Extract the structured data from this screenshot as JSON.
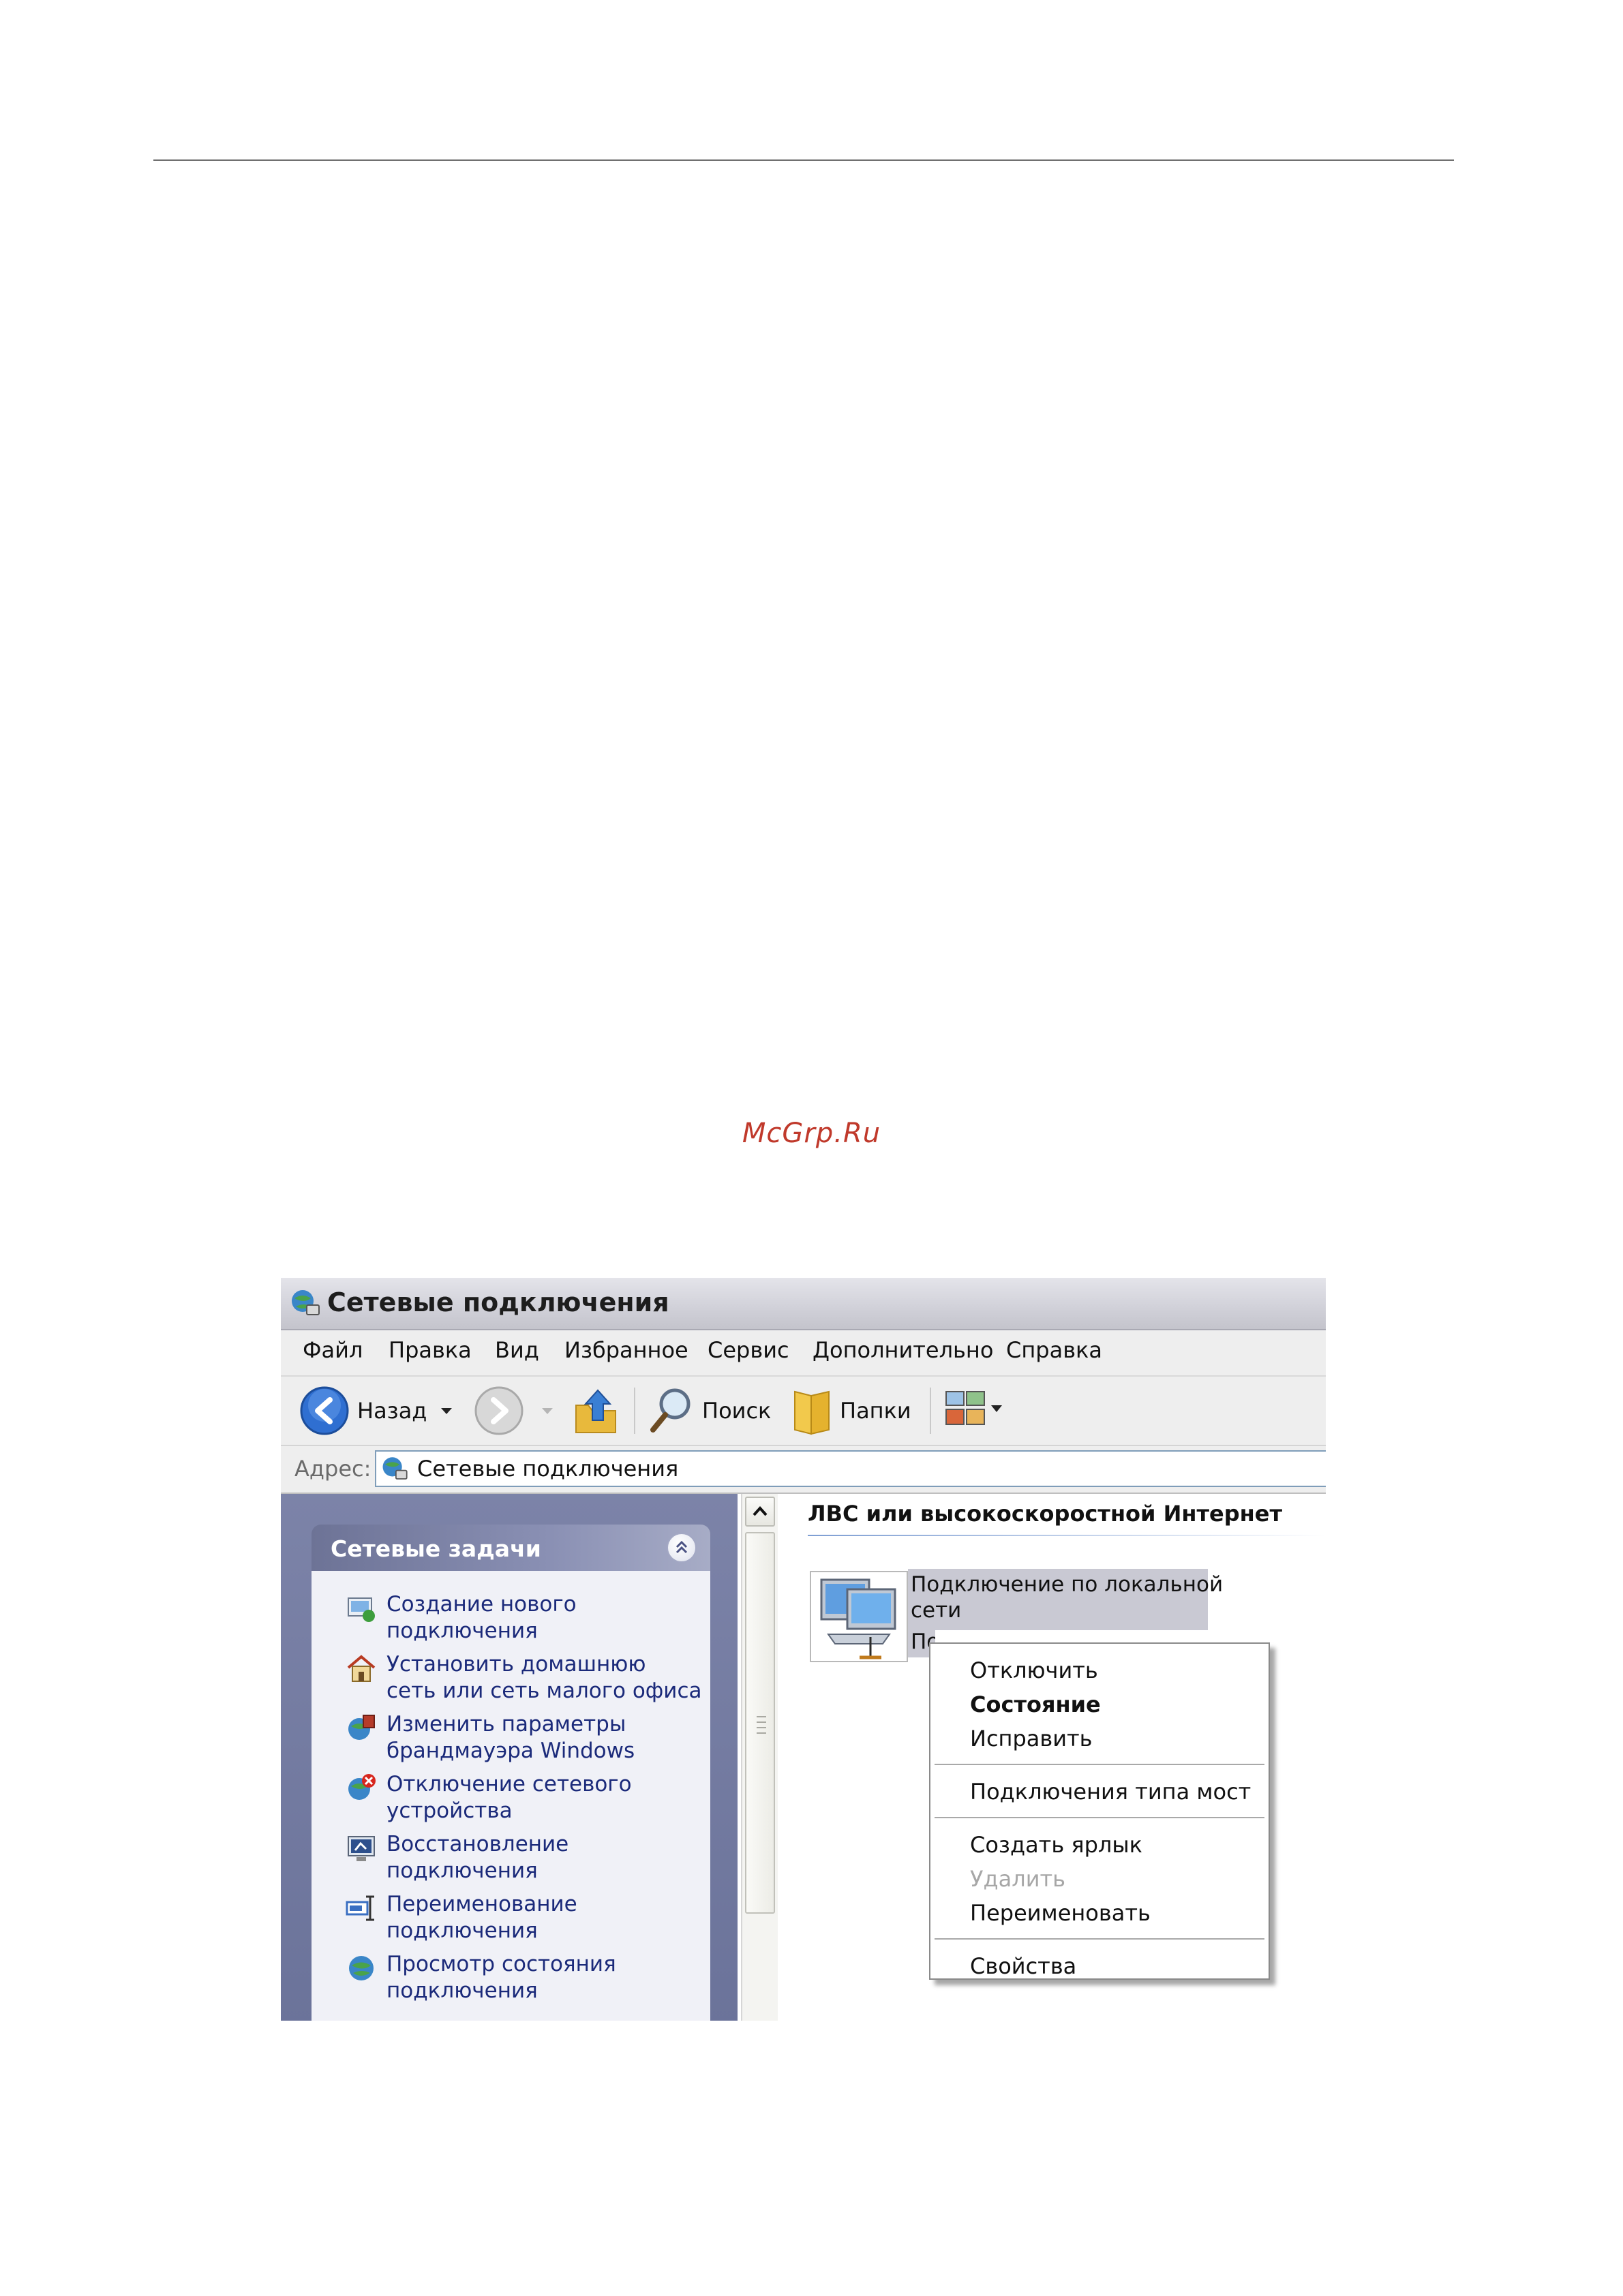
{
  "watermark": "McGrp.Ru",
  "window": {
    "title": "Сетевые подключения",
    "menu": [
      "Файл",
      "Правка",
      "Вид",
      "Избранное",
      "Сервис",
      "Дополнительно",
      "Справка"
    ],
    "toolbar": {
      "back_label": "Назад",
      "search_label": "Поиск",
      "folders_label": "Папки"
    },
    "address": {
      "label": "Адрес:",
      "value": "Сетевые подключения"
    }
  },
  "tasks": {
    "header": "Сетевые задачи",
    "items": [
      {
        "line1": "Создание нового",
        "line2": "подключения",
        "icon": "new-connection-icon"
      },
      {
        "line1": "Установить домашнюю",
        "line2": "сеть или сеть малого офиса",
        "icon": "home-network-icon"
      },
      {
        "line1": "Изменить параметры",
        "line2": "брандмауэра Windows",
        "icon": "firewall-icon"
      },
      {
        "line1": "Отключение сетевого",
        "line2": "устройства",
        "icon": "disable-device-icon"
      },
      {
        "line1": "Восстановление",
        "line2": "подключения",
        "icon": "repair-connection-icon"
      },
      {
        "line1": "Переименование",
        "line2": "подключения",
        "icon": "rename-icon"
      },
      {
        "line1": "Просмотр состояния",
        "line2": "подключения",
        "icon": "view-status-icon"
      }
    ]
  },
  "content": {
    "group_header": "ЛВС или высокоскоростной Интернет",
    "connection": {
      "line1": "Подключение по локальной",
      "line2": "сети",
      "line3": "По"
    }
  },
  "context_menu": {
    "items": [
      {
        "label": "Отключить"
      },
      {
        "label": "Состояние",
        "bold": true
      },
      {
        "label": "Исправить"
      },
      {
        "label": "Подключения типа мост"
      },
      {
        "label": "Создать ярлык"
      },
      {
        "label": "Удалить",
        "disabled": true
      },
      {
        "label": "Переименовать"
      },
      {
        "label": "Свойства"
      }
    ]
  },
  "colors": {
    "task_link": "#1b2a7a",
    "panel_bg": "#7c83a8",
    "selection": "#c9c9d3",
    "watermark": "#c0392b"
  }
}
